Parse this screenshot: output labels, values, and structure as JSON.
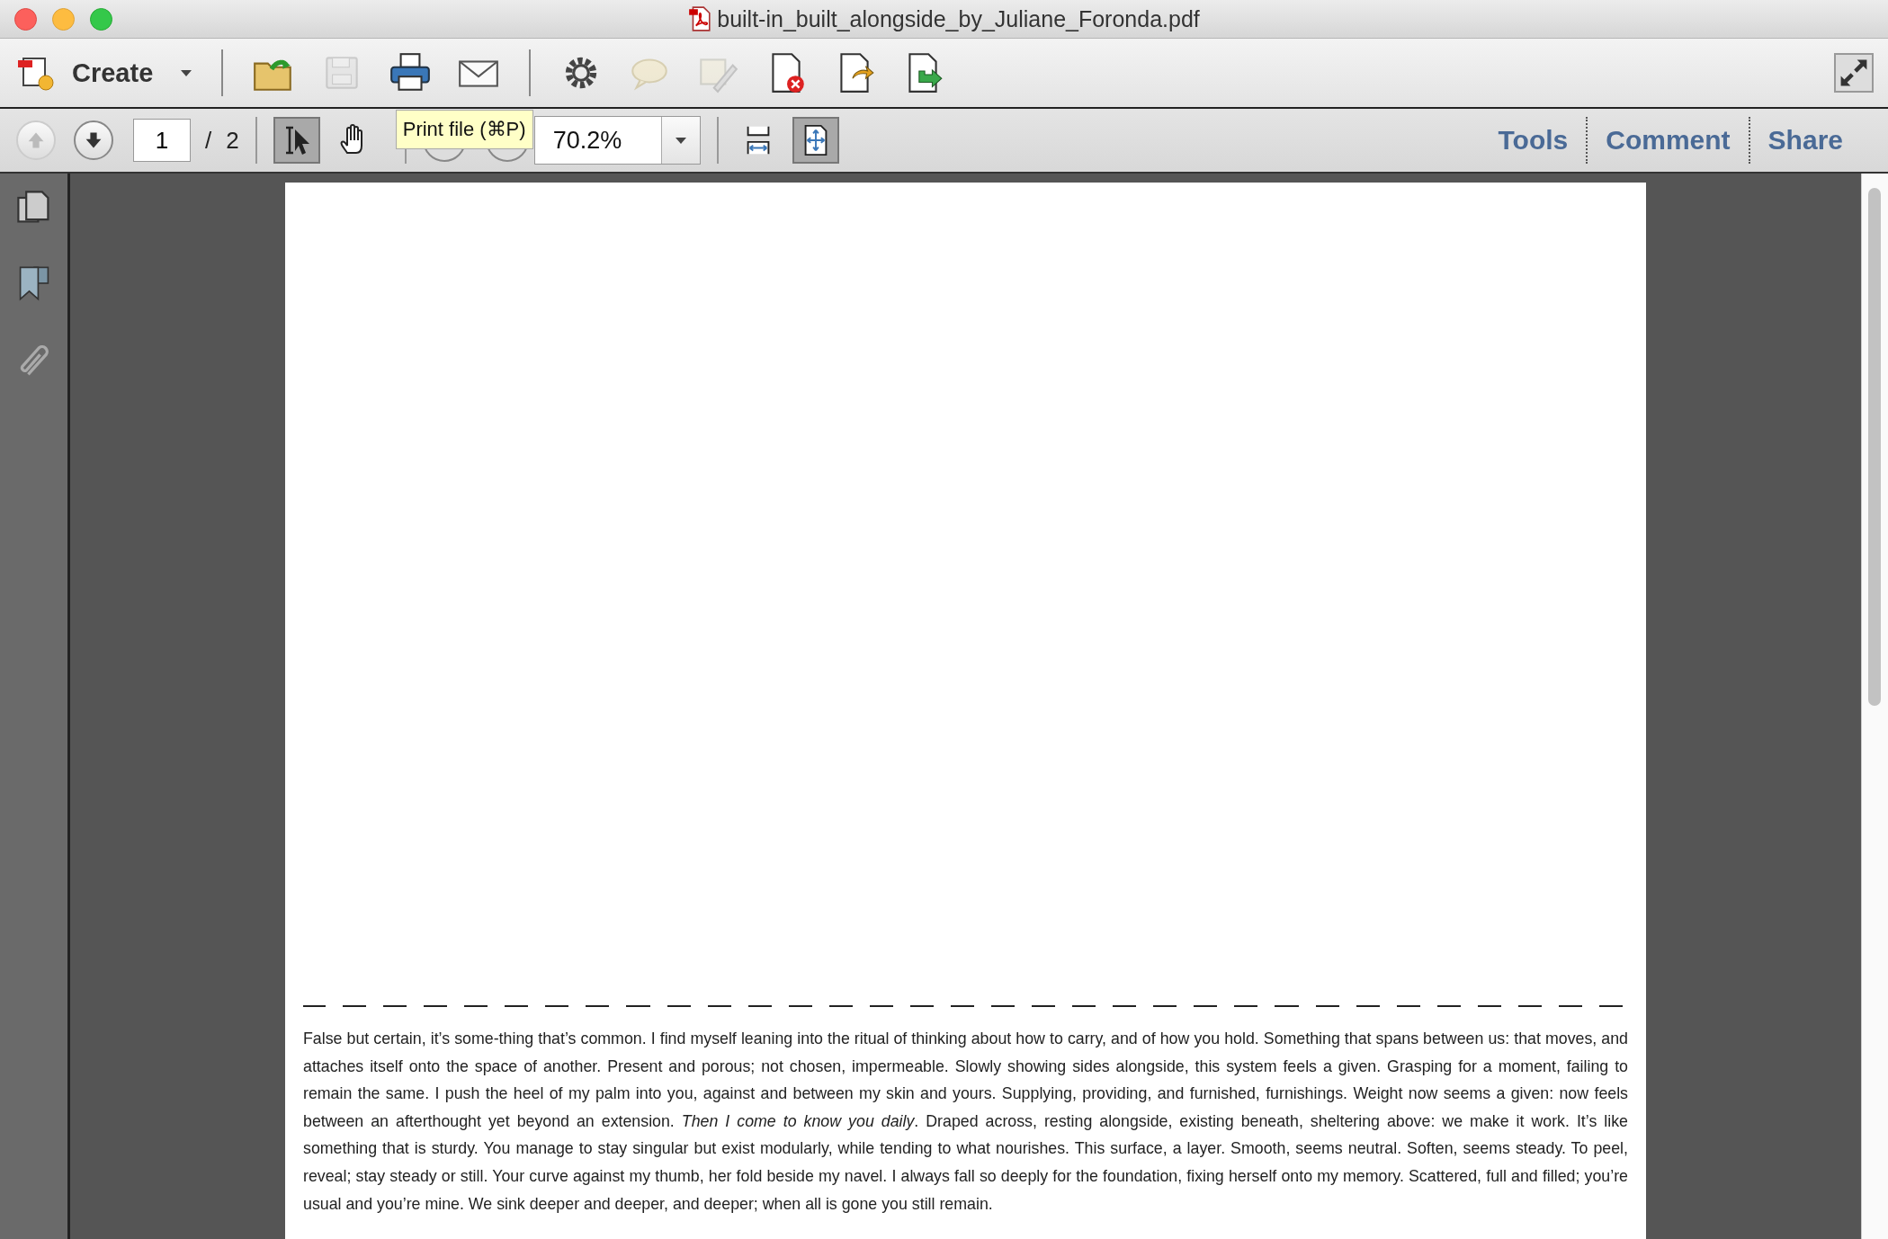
{
  "window": {
    "title": "built-in_built_alongside_by_Juliane_Foronda.pdf"
  },
  "toolbar": {
    "create_label": "Create",
    "file_tools": [
      {
        "kind": "open",
        "disabled": false
      },
      {
        "kind": "save",
        "disabled": true
      },
      {
        "kind": "print",
        "disabled": false
      },
      {
        "kind": "email",
        "disabled": false
      }
    ],
    "doc_tools": [
      {
        "kind": "settings",
        "disabled": false
      },
      {
        "kind": "comment",
        "disabled": true
      },
      {
        "kind": "sign",
        "disabled": true
      },
      {
        "kind": "delete-page",
        "disabled": false
      },
      {
        "kind": "export",
        "disabled": false
      },
      {
        "kind": "send",
        "disabled": false
      }
    ]
  },
  "navbar": {
    "prev_disabled": true,
    "page": "1",
    "separator": "/",
    "total": "2",
    "modes": [
      {
        "kind": "select",
        "selected": true
      },
      {
        "kind": "hand",
        "selected": false
      }
    ],
    "zoom": "70.2%",
    "fit": [
      {
        "kind": "width",
        "selected": false
      },
      {
        "kind": "page",
        "selected": true
      }
    ],
    "tooltip": "Print file (⌘P)",
    "panels": [
      {
        "label": "Tools"
      },
      {
        "label": "Comment"
      },
      {
        "label": "Share"
      }
    ]
  },
  "document": {
    "paragraph": "False but certain, it’s some-thing that’s common. I find myself leaning into the ritual of thinking about how to carry, and of how you hold. Something that spans between us: that moves, and attaches itself onto the space of another. Present and porous; not chosen, impermeable. Slowly showing sides alongside, this system feels a given. Grasping for a moment, failing to remain the same. I push the heel of my palm into you, against and between my skin and yours. Supplying, providing, and furnished, furnishings. Weight now seems a given: now feels between an afterthought yet beyond an extension. *Then I come to know you daily*. Draped across, resting alongside, existing beneath, sheltering above: we make it work. It’s like something that is sturdy. You manage to stay singular but exist modularly, while tending to what nourishes. This surface, a layer. Smooth, seems neutral. Soften, seems steady. To peel, reveal; stay steady or still. Your curve against my thumb, her fold beside my navel. I always fall so deeply for the foundation, fixing herself onto my memory. Scattered, full and filled; you’re usual and you’re mine. We sink deeper and deeper, and deeper; when all is gone you still remain."
  }
}
